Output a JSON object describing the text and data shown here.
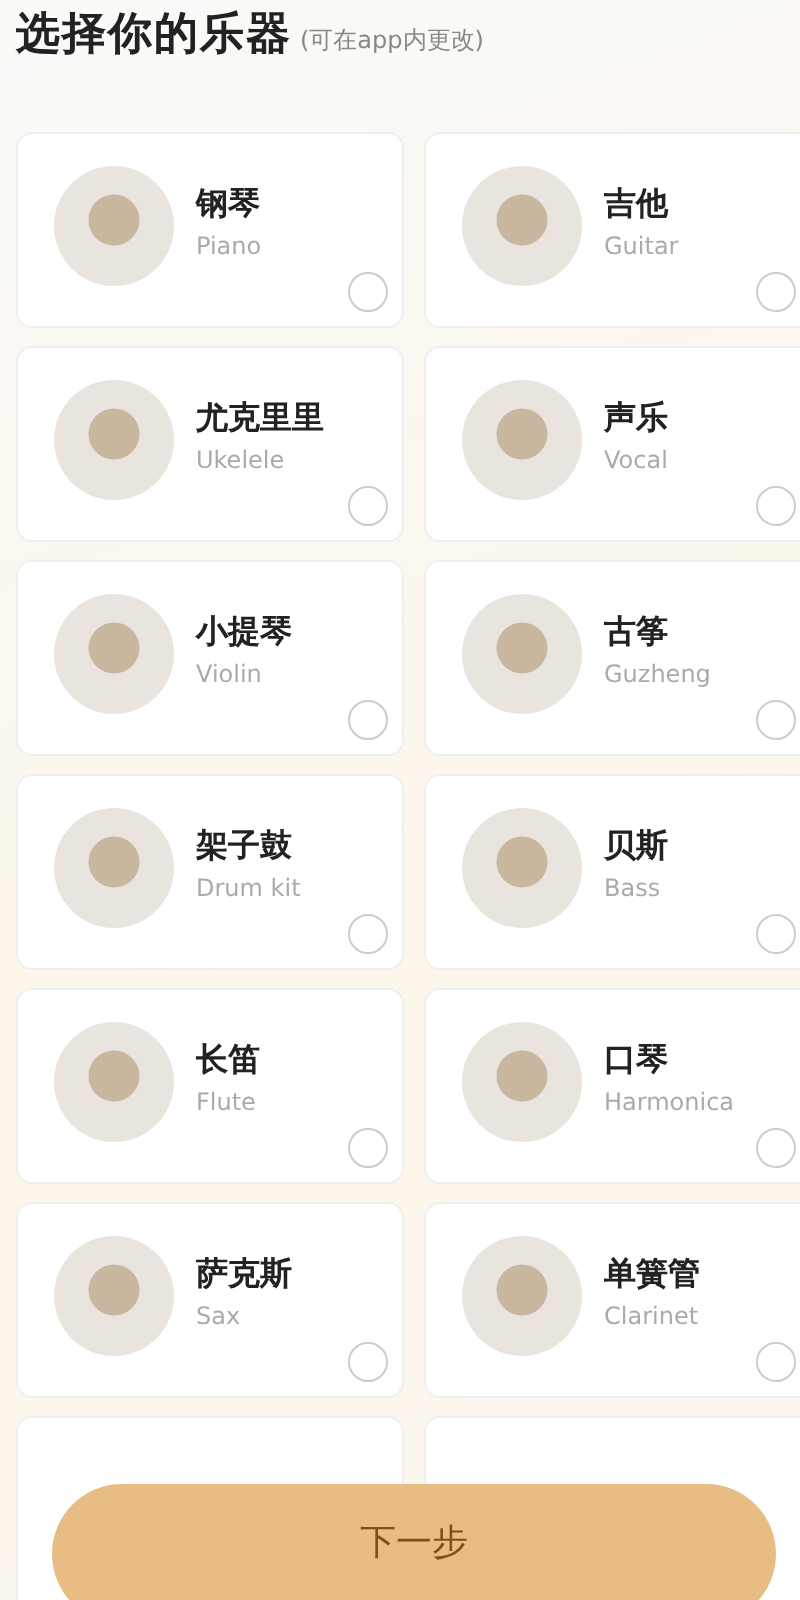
{
  "header": {
    "title": "选择你的乐器",
    "note": "(可在app内更改)"
  },
  "instruments": [
    {
      "name": "钢琴",
      "english": "Piano",
      "selected": false
    },
    {
      "name": "吉他",
      "english": "Guitar",
      "selected": false
    },
    {
      "name": "尤克里里",
      "english": "Ukelele",
      "selected": false
    },
    {
      "name": "声乐",
      "english": "Vocal",
      "selected": false
    },
    {
      "name": "小提琴",
      "english": "Violin",
      "selected": false
    },
    {
      "name": "古筝",
      "english": "Guzheng",
      "selected": false
    },
    {
      "name": "架子鼓",
      "english": "Drum kit",
      "selected": false
    },
    {
      "name": "贝斯",
      "english": "Bass",
      "selected": false
    },
    {
      "name": "长笛",
      "english": "Flute",
      "selected": false
    },
    {
      "name": "口琴",
      "english": "Harmonica",
      "selected": false
    },
    {
      "name": "萨克斯",
      "english": "Sax",
      "selected": false
    },
    {
      "name": "单簧管",
      "english": "Clarinet",
      "selected": false
    }
  ],
  "next_button": "下一步"
}
